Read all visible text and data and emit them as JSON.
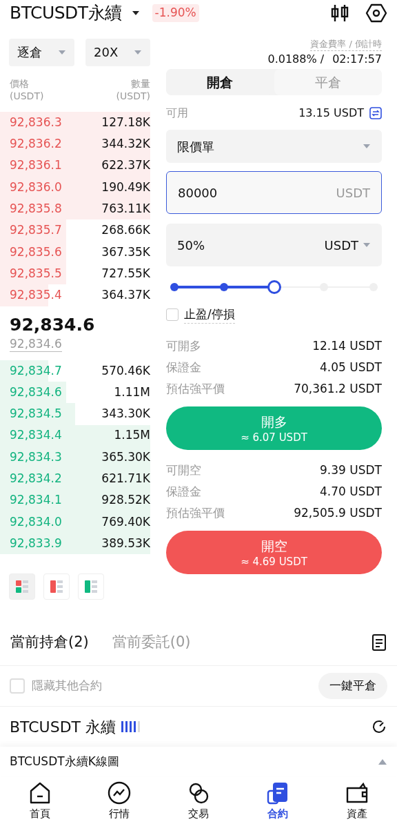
{
  "header": {
    "symbol": "BTCUSDT永續",
    "change": "-1.90%"
  },
  "margin_mode": {
    "label": "逐倉"
  },
  "leverage": {
    "label": "20X"
  },
  "funding": {
    "label": "資金費率 / 倒計時",
    "rate": "0.0188% /",
    "countdown": "02:17:57"
  },
  "orderbook": {
    "price_header": "價格",
    "price_unit": "(USDT)",
    "qty_header": "數量",
    "qty_unit": "(USDT)",
    "asks": [
      {
        "price": "92,836.3",
        "qty": "127.18K"
      },
      {
        "price": "92,836.2",
        "qty": "344.32K"
      },
      {
        "price": "92,836.1",
        "qty": "622.37K"
      },
      {
        "price": "92,836.0",
        "qty": "190.49K"
      },
      {
        "price": "92,835.8",
        "qty": "763.11K"
      },
      {
        "price": "92,835.7",
        "qty": "268.66K"
      },
      {
        "price": "92,835.6",
        "qty": "367.35K"
      },
      {
        "price": "92,835.5",
        "qty": "727.55K"
      },
      {
        "price": "92,835.4",
        "qty": "364.37K"
      }
    ],
    "last_price": "92,834.6",
    "mark_price": "92,834.6",
    "bids": [
      {
        "price": "92,834.7",
        "qty": "570.46K"
      },
      {
        "price": "92,834.6",
        "qty": "1.11M"
      },
      {
        "price": "92,834.5",
        "qty": "343.30K"
      },
      {
        "price": "92,834.4",
        "qty": "1.15M"
      },
      {
        "price": "92,834.3",
        "qty": "365.30K"
      },
      {
        "price": "92,834.2",
        "qty": "621.71K"
      },
      {
        "price": "92,834.1",
        "qty": "928.52K"
      },
      {
        "price": "92,834.0",
        "qty": "769.40K"
      },
      {
        "price": "92,833.9",
        "qty": "389.53K"
      }
    ],
    "views": [
      {
        "kind": "both",
        "selected": true
      },
      {
        "kind": "asks",
        "selected": false
      },
      {
        "kind": "bids",
        "selected": false
      }
    ]
  },
  "tabs": [
    {
      "label": "開倉",
      "selected": true
    },
    {
      "label": "平倉",
      "selected": false
    }
  ],
  "available": {
    "label": "可用",
    "value": "13.15 USDT"
  },
  "order_type": {
    "value": "限價單"
  },
  "price_field": {
    "value": "80000",
    "unit": "USDT"
  },
  "amount_field": {
    "value": "50%",
    "unit": "USDT"
  },
  "slider": {
    "level": 0.5
  },
  "tp_sl": {
    "label": "止盈/停損",
    "checked": false
  },
  "long": {
    "rows": [
      {
        "label": "可開多",
        "value": "12.14 USDT"
      },
      {
        "label": "保證金",
        "value": "4.05 USDT"
      },
      {
        "label": "預估強平價",
        "value": "70,361.2 USDT"
      }
    ],
    "button": "開多",
    "sub": "≈ 6.07 USDT"
  },
  "short": {
    "rows": [
      {
        "label": "可開空",
        "value": "9.39 USDT"
      },
      {
        "label": "保證金",
        "value": "4.70 USDT"
      },
      {
        "label": "預估強平價",
        "value": "92,505.9 USDT"
      }
    ],
    "button": "開空",
    "sub": "≈ 4.69 USDT"
  },
  "position_tabs": [
    {
      "label": "當前持倉(2)",
      "selected": true
    },
    {
      "label": "當前委託(0)",
      "selected": false
    }
  ],
  "hide_others": {
    "label": "隱藏其他合約",
    "checked": false
  },
  "close_all": "一鍵平倉",
  "position": {
    "title": "BTCUSDT 永續"
  },
  "kline_bar": {
    "title": "BTCUSDT永續K線圖"
  },
  "nav": [
    {
      "label": "首頁",
      "kind": "home",
      "selected": false
    },
    {
      "label": "行情",
      "kind": "market",
      "selected": false
    },
    {
      "label": "交易",
      "kind": "trade",
      "selected": false
    },
    {
      "label": "合約",
      "kind": "futures",
      "selected": true
    },
    {
      "label": "資產",
      "kind": "assets",
      "selected": false
    }
  ]
}
